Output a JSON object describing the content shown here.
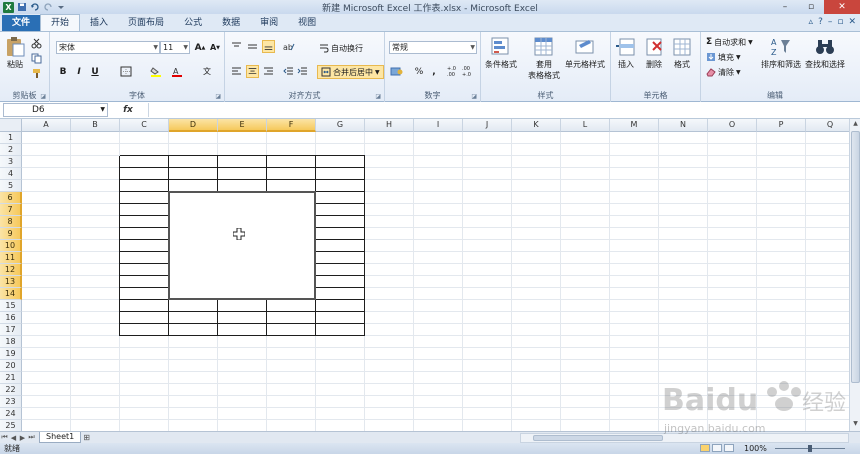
{
  "window": {
    "title": "新建 Microsoft Excel 工作表.xlsx - Microsoft Excel",
    "controls": [
      "–",
      "▫",
      "✕"
    ]
  },
  "ribbon_tabs": {
    "file": "文件",
    "items": [
      "开始",
      "插入",
      "页面布局",
      "公式",
      "数据",
      "审阅",
      "视图"
    ],
    "active": "开始"
  },
  "clipboard": {
    "paste": "粘贴",
    "label": "剪贴板"
  },
  "font": {
    "name": "宋体",
    "size": "11",
    "label": "字体",
    "bold": "B",
    "italic": "I",
    "underline": "U",
    "grow": "A",
    "shrink": "A",
    "wen": "文"
  },
  "alignment": {
    "wrap": "自动换行",
    "merge": "合并后居中",
    "label": "对齐方式"
  },
  "number": {
    "format": "常规",
    "percent": "%",
    "comma": ",",
    "inc": "+.0 .00",
    "dec": ".00 +.0",
    "label": "数字"
  },
  "styles": {
    "conditional": "条件格式",
    "table1": "套用",
    "table2": "表格格式",
    "cell": "单元格样式",
    "label": "样式"
  },
  "cells": {
    "insert": "插入",
    "delete": "删除",
    "format": "格式",
    "label": "单元格"
  },
  "editing": {
    "autosum": "自动求和",
    "fill": "填充",
    "clear": "清除",
    "sort": "排序和筛选",
    "find": "查找和选择",
    "label": "编辑"
  },
  "formula_bar": {
    "name_box": "D6",
    "fx": "fx",
    "value": ""
  },
  "columns": [
    "A",
    "B",
    "C",
    "D",
    "E",
    "F",
    "G",
    "H",
    "I",
    "J",
    "K",
    "L",
    "M",
    "N",
    "O",
    "P",
    "Q"
  ],
  "selected_columns": [
    "D",
    "E",
    "F"
  ],
  "rows": [
    "1",
    "2",
    "3",
    "4",
    "5",
    "6",
    "7",
    "8",
    "9",
    "10",
    "11",
    "12",
    "13",
    "14",
    "15",
    "16",
    "17",
    "18",
    "19",
    "20",
    "21",
    "22",
    "23",
    "24",
    "25"
  ],
  "selected_rows": [
    "6",
    "7",
    "8",
    "9",
    "10",
    "11",
    "12",
    "13",
    "14"
  ],
  "sheets": {
    "tabs": [
      "Sheet1"
    ]
  },
  "status": {
    "text": "就绪",
    "zoom": "100%"
  },
  "watermark": {
    "brand": "Baidu",
    "cn": "经验",
    "url": "jingyan.baidu.com"
  }
}
